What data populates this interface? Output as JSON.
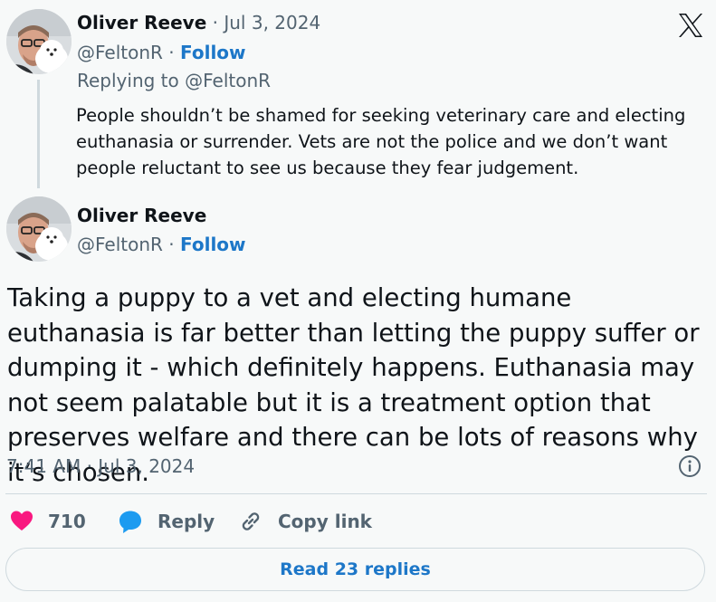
{
  "reply_tweet": {
    "author_name": "Oliver Reeve",
    "separator": " · ",
    "date": "Jul 3, 2024",
    "handle": "@FeltonR",
    "follow_sep": " · ",
    "follow_label": "Follow",
    "replying_to": "Replying to @FeltonR",
    "text": "People shouldn’t be shamed for seeking veterinary care and electing euthanasia or surrender. Vets are not the police and we don’t want people reluctant to see us because they fear judgement."
  },
  "main_tweet": {
    "author_name": "Oliver Reeve",
    "handle": "@FeltonR",
    "follow_sep": " · ",
    "follow_label": "Follow",
    "text": "Taking a puppy to a vet and electing humane euthanasia is far better than letting the puppy suffer or dumping it - which definitely happens. Euthanasia may not seem palatable but it is a treatment option that preserves welfare and there can be lots of reasons why it’s chosen.",
    "timestamp": "7:41 AM · Jul 3, 2024"
  },
  "actions": {
    "like_count": "710",
    "reply_label": "Reply",
    "copy_link_label": "Copy link"
  },
  "footer": {
    "read_replies_label": "Read 23 replies"
  },
  "icons": {
    "logo": "x-logo-icon",
    "info": "info-icon",
    "heart": "heart-icon",
    "reply": "reply-bubble-icon",
    "link": "link-icon"
  },
  "colors": {
    "follow": "#1d77c8",
    "heart": "#f91880",
    "reply_bubble": "#1d9bf0"
  }
}
